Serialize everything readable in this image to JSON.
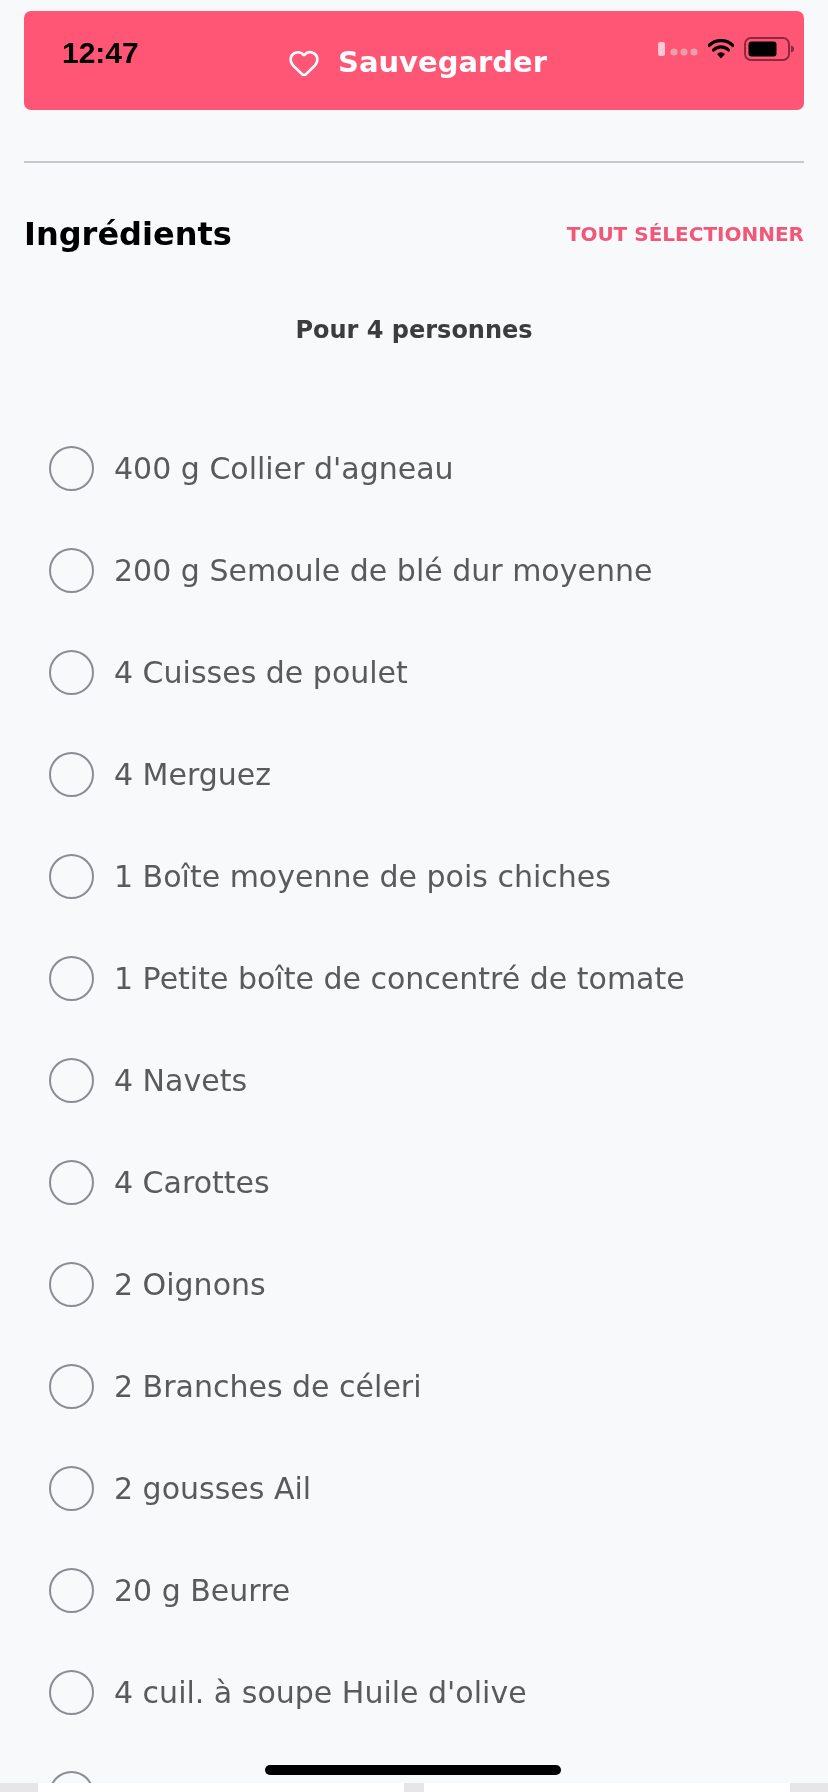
{
  "status_bar": {
    "time": "12:47"
  },
  "save_button": {
    "label": "Sauvegarder",
    "saved": false
  },
  "section": {
    "title": "Ingrédients",
    "action": "TOUT SÉLECTIONNER"
  },
  "servings": "Pour 4 personnes",
  "ingredients": [
    {
      "label": "400 g Collier d'agneau",
      "checked": false
    },
    {
      "label": "200 g Semoule de blé dur moyenne",
      "checked": false
    },
    {
      "label": "4 Cuisses de poulet",
      "checked": false
    },
    {
      "label": "4 Merguez",
      "checked": false
    },
    {
      "label": "1 Boîte moyenne de pois chiches",
      "checked": false
    },
    {
      "label": "1 Petite boîte de concentré de tomate",
      "checked": false
    },
    {
      "label": "4 Navets",
      "checked": false
    },
    {
      "label": "4 Carottes",
      "checked": false
    },
    {
      "label": "2 Oignons",
      "checked": false
    },
    {
      "label": "2 Branches de céleri",
      "checked": false
    },
    {
      "label": "2 gousses Ail",
      "checked": false
    },
    {
      "label": "20 g Beurre",
      "checked": false
    },
    {
      "label": "4 cuil. à soupe Huile d'olive",
      "checked": false
    },
    {
      "checked": false
    }
  ]
}
